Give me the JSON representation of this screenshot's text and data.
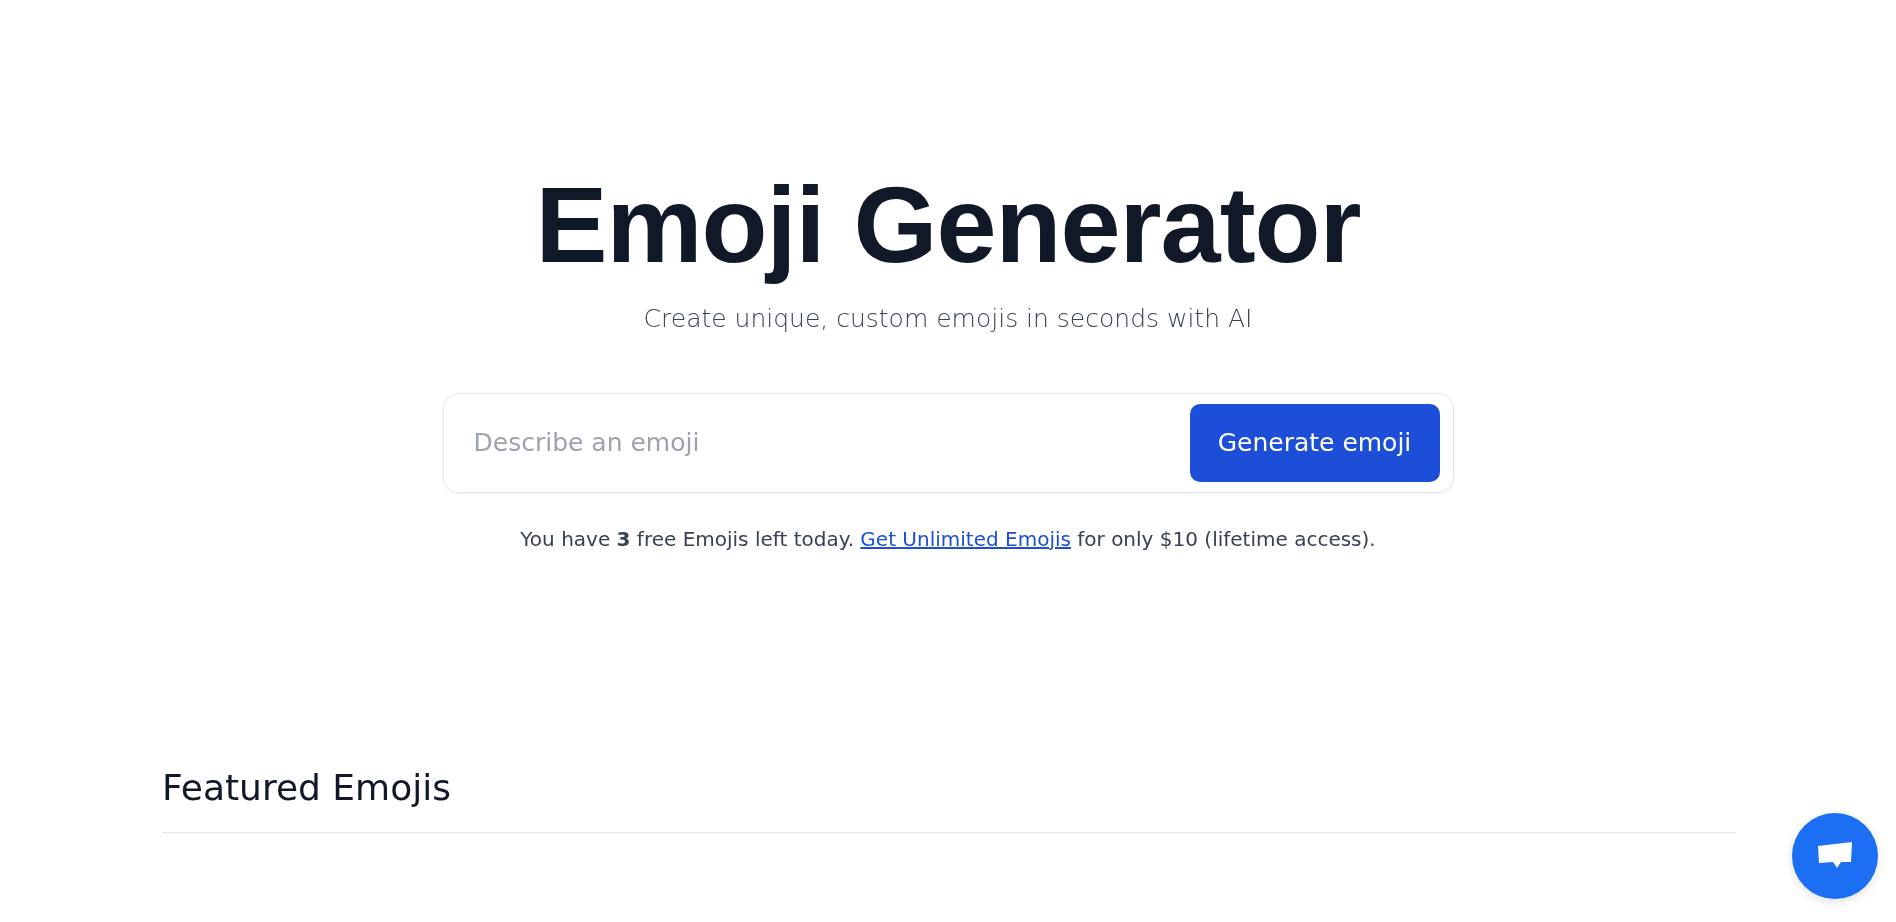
{
  "hero": {
    "title": "Emoji Generator",
    "subtitle": "Create unique, custom emojis in seconds with AI"
  },
  "prompt": {
    "placeholder": "Describe an emoji",
    "button": "Generate emoji"
  },
  "note": {
    "before": "You have **3** free Emojis left today. ",
    "link": "Get Unlimited Emojis",
    "after": " for only $10 (lifetime access)."
  },
  "featured": {
    "heading": "Featured Emojis"
  }
}
